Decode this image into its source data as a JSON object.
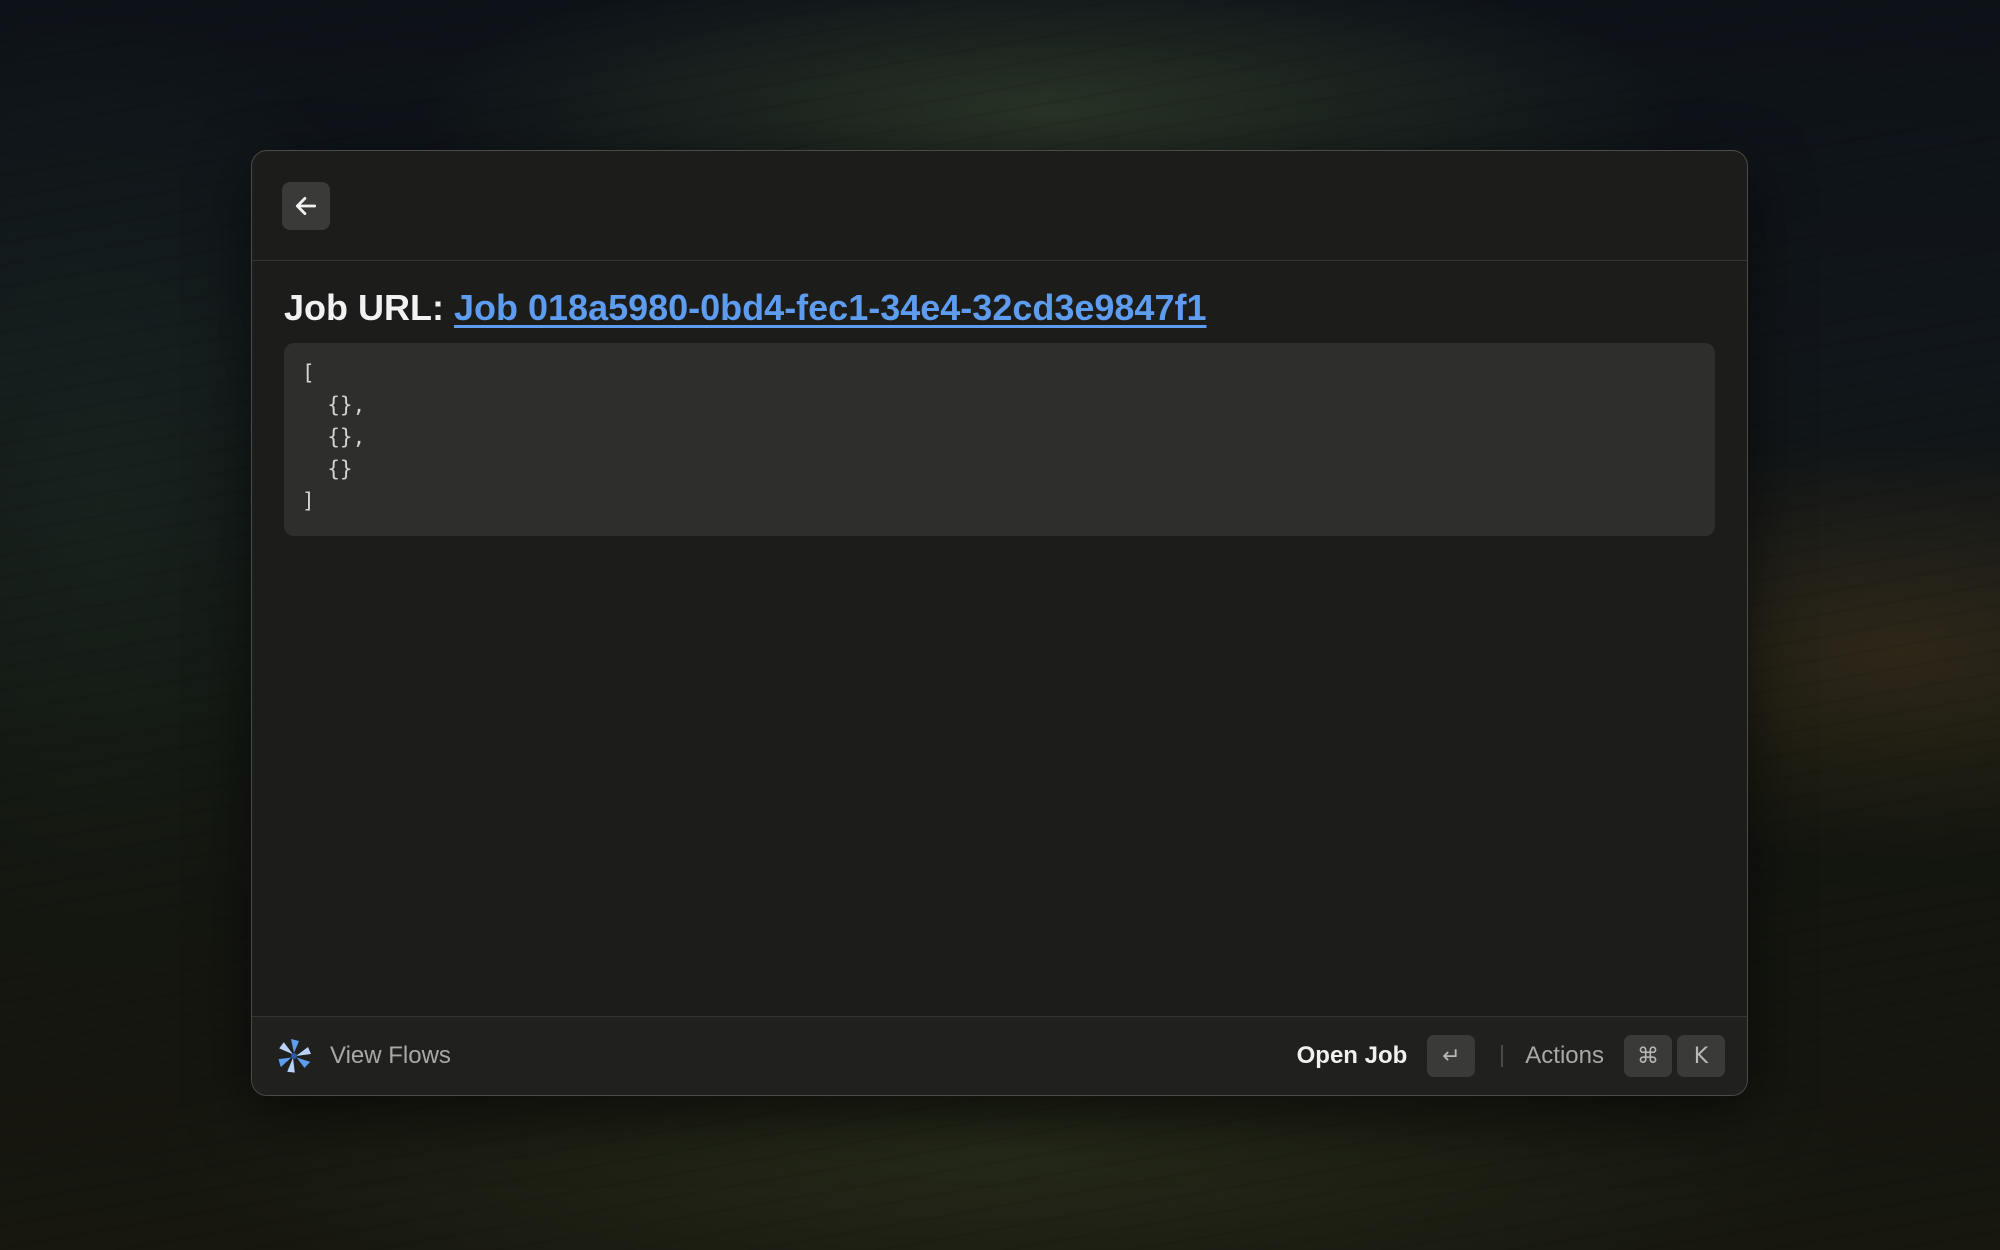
{
  "header": {
    "back_icon": "arrow-left-icon"
  },
  "content": {
    "job_label": "Job URL:",
    "job_link_text": "Job 018a5980-0bd4-fec1-34e4-32cd3e9847f1",
    "code": "[\n  {},\n  {},\n  {}\n]"
  },
  "footer": {
    "app_icon": "windmill-icon",
    "view_flows_label": "View Flows",
    "primary_action_label": "Open Job",
    "primary_action_key": "↵",
    "secondary_action_label": "Actions",
    "secondary_action_keys": [
      "⌘",
      "K"
    ]
  },
  "colors": {
    "link": "#5e9cf0",
    "window_bg": "#1c1c1a",
    "code_bg": "#2e2e2c"
  }
}
